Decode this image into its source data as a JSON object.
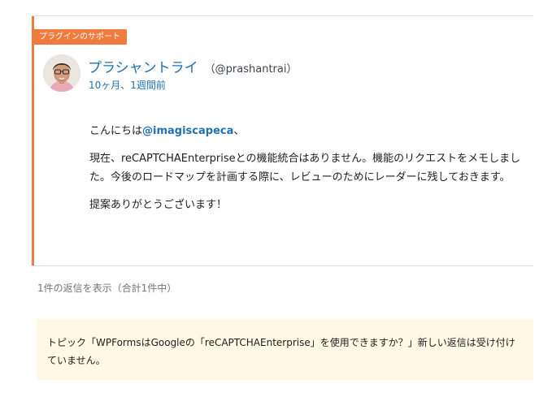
{
  "reply": {
    "badge": "プラグインのサポート",
    "author_name": "プラシャントライ",
    "author_handle": "（@prashantrai）",
    "time": "10ヶ月、1週間前",
    "greeting_prefix": "こんにちは",
    "mention": "@imagiscapeca",
    "greeting_suffix": "、",
    "paragraph_1": "現在、reCAPTCHAEnterpriseとの機能統合はありません。機能のリクエストをメモしました。今後のロードマップを計画する際に、レビューのためにレーダーに残しておきます。",
    "paragraph_2": "提案ありがとうございます！"
  },
  "reply_count": "1件の返信を表示（合計1件中）",
  "closed_notice": "トピック「WPFormsはGoogleの「reCAPTCHAEnterprise」を使用できますか？」新しい返信は受け付けていません。",
  "colors": {
    "accent": "#f07b3e",
    "link": "#2271b1",
    "notice_bg": "#fff8e5"
  }
}
